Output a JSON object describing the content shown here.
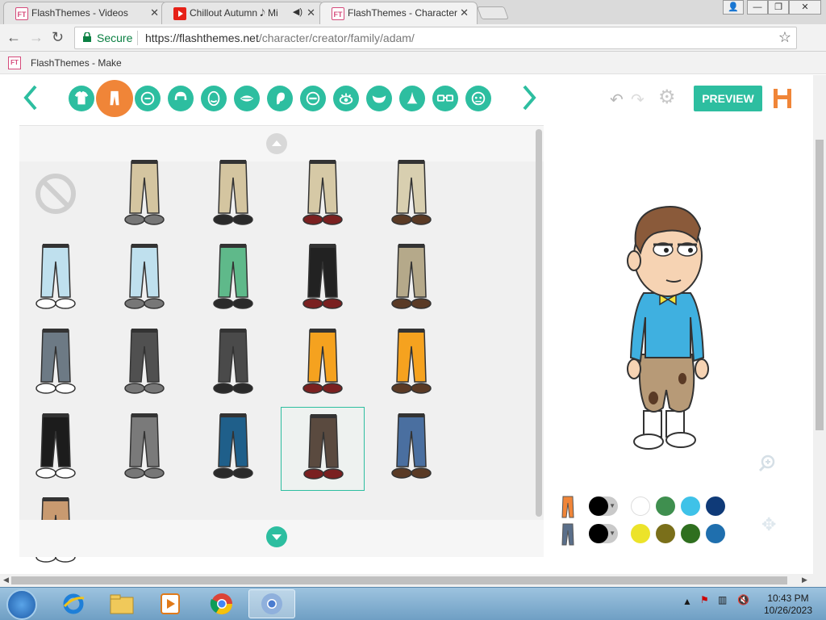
{
  "browser": {
    "tabs": [
      {
        "title": "FlashThemes - Videos",
        "favicon": "ft-logo",
        "active": false
      },
      {
        "title": "Chillout Autumn 𝅘𝅥𝅮 Mi",
        "favicon": "youtube-logo",
        "active": false,
        "audio": true
      },
      {
        "title": "FlashThemes - Character",
        "favicon": "ft-logo",
        "active": true
      }
    ],
    "favicon_text": "FT",
    "address": {
      "secure_label": "Secure",
      "url_host": "https://flashthemes.net",
      "url_path": "/character/creator/family/adam/"
    },
    "bookmark": "FlashThemes - Make"
  },
  "creator": {
    "category_icons": [
      "shirt-icon",
      "pants-icon",
      "face-shape-icon",
      "hair-icon",
      "head-icon",
      "mouth-icon",
      "ear-icon",
      "eyebrow-icon",
      "eye-icon",
      "beard-icon",
      "nose-icon",
      "glasses-icon",
      "face-accessory-icon"
    ],
    "active_category": "pants-icon",
    "preview_label": "PREVIEW",
    "items": [
      {
        "name": "none",
        "color": "#cccccc"
      },
      {
        "name": "khaki-pants-white-sneakers",
        "color": "#d4c5a0"
      },
      {
        "name": "khaki-shorts-sandals",
        "color": "#d4c5a0"
      },
      {
        "name": "khaki-pants-white-shoes",
        "color": "#d6c9a6"
      },
      {
        "name": "cargo-khaki-pants",
        "color": "#d8cfb0"
      },
      {
        "name": "light-blue-pants-gray-shoes",
        "color": "#bfe0ee"
      },
      {
        "name": "light-blue-pants-sandals",
        "color": "#bfe0ee"
      },
      {
        "name": "green-shorts-socks",
        "color": "#5fb98a"
      },
      {
        "name": "black-white-track-pants",
        "color": "#222222"
      },
      {
        "name": "camo-cargo-pants",
        "color": "#b5a98a"
      },
      {
        "name": "gray-jeans-black-boots",
        "color": "#6d7a85"
      },
      {
        "name": "dark-gray-torn-pants",
        "color": "#505050"
      },
      {
        "name": "dark-gray-bloody-pants",
        "color": "#4a4a4a"
      },
      {
        "name": "orange-shorts-white-stripe",
        "color": "#f5a21f"
      },
      {
        "name": "orange-shorts-red-sneakers",
        "color": "#f5a21f"
      },
      {
        "name": "black-pants-red-boots",
        "color": "#1c1c1c"
      },
      {
        "name": "gray-pants-black-boots",
        "color": "#7a7a7a"
      },
      {
        "name": "blue-jeans-white-shoes",
        "color": "#1f5f8a"
      },
      {
        "name": "brown-muddy-pants",
        "color": "#5a4a3f"
      },
      {
        "name": "blue-jeans-holster-boots",
        "color": "#4a6fa0"
      },
      {
        "name": "tan-pants",
        "color": "#c89a70"
      }
    ],
    "selected_index": 18,
    "color_rows": [
      {
        "icon": "pants-color-icon",
        "icon_color": "#f08538",
        "swatches": [
          "#000000",
          "#ffffff",
          "#3f8f4f",
          "#3fc2e8",
          "#0f3a78"
        ]
      },
      {
        "icon": "pants-secondary-color-icon",
        "icon_color": "#5a6f8a",
        "swatches": [
          "#000000",
          "#ece32a",
          "#7a6f1a",
          "#2f6f1f",
          "#1f6fae"
        ]
      }
    ]
  },
  "taskbar": {
    "apps": [
      "internet-explorer-icon",
      "file-explorer-icon",
      "media-player-icon",
      "chrome-icon",
      "chrome-active-icon"
    ],
    "time": "10:43 PM",
    "date": "10/26/2023"
  }
}
